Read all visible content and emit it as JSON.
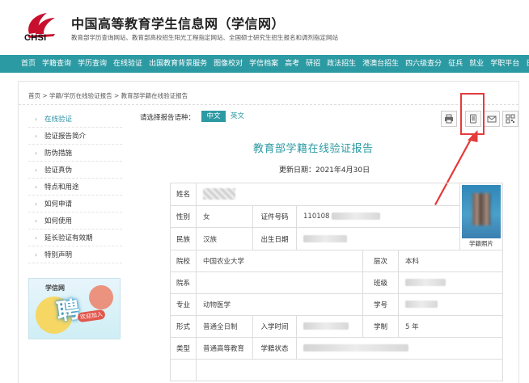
{
  "header": {
    "logo_text": "CHSI",
    "title": "中国高等教育学生信息网（学信网）",
    "subtitle": "教育部学历查询网站、教育部高校招生阳光工程指定网站、全国硕士研究生招生报名和调剂指定网站"
  },
  "nav": [
    "首页",
    "学籍查询",
    "学历查询",
    "在线验证",
    "出国教育背景服务",
    "图像校对",
    "学信档案",
    "高考",
    "研招",
    "政法招生",
    "港澳台招生",
    "四六级查分",
    "征兵",
    "就业",
    "学职平台",
    "日本频道"
  ],
  "breadcrumb": "首页 > 学籍/学历在线验证报告 > 教育部学籍在线验证报告",
  "sidebar": {
    "items": [
      "在线验证",
      "验证报告简介",
      "防伪措施",
      "验证真伪",
      "特点和用途",
      "如何申请",
      "如何使用",
      "延长验证有效期",
      "特别声明"
    ],
    "active_index": 0,
    "banner": {
      "logo": "学信网",
      "big": "聘",
      "small": "欢迎加入"
    }
  },
  "lang": {
    "label": "请选择报告语种：",
    "zh": "中文",
    "en": "英文"
  },
  "tools": [
    "print-icon",
    "phone-icon",
    "email-icon",
    "qrcode-icon"
  ],
  "report": {
    "title": "教育部学籍在线验证报告",
    "update": "更新日期：2021年4月30日"
  },
  "table": {
    "name_label": "姓名",
    "gender_label": "性别",
    "gender_value": "女",
    "id_label": "证件号码",
    "id_value_prefix": "110108",
    "ethnicity_label": "民族",
    "ethnicity_value": "汉族",
    "birth_label": "出生日期",
    "photo_caption": "学籍照片",
    "school_label": "院校",
    "school_value": "中国农业大学",
    "level_label": "层次",
    "level_value": "本科",
    "dept_label": "院系",
    "class_label": "班级",
    "major_label": "专业",
    "major_value": "动物医学",
    "student_no_label": "学号",
    "form_label": "形式",
    "form_value": "普通全日制",
    "enroll_label": "入学时间",
    "duration_label": "学制",
    "duration_value": "5 年",
    "type_label": "类型",
    "type_value": "普通高等教育",
    "status_label": "学籍状态"
  },
  "colors": {
    "accent": "#2c9aa3",
    "highlight": "#e53b3b"
  }
}
